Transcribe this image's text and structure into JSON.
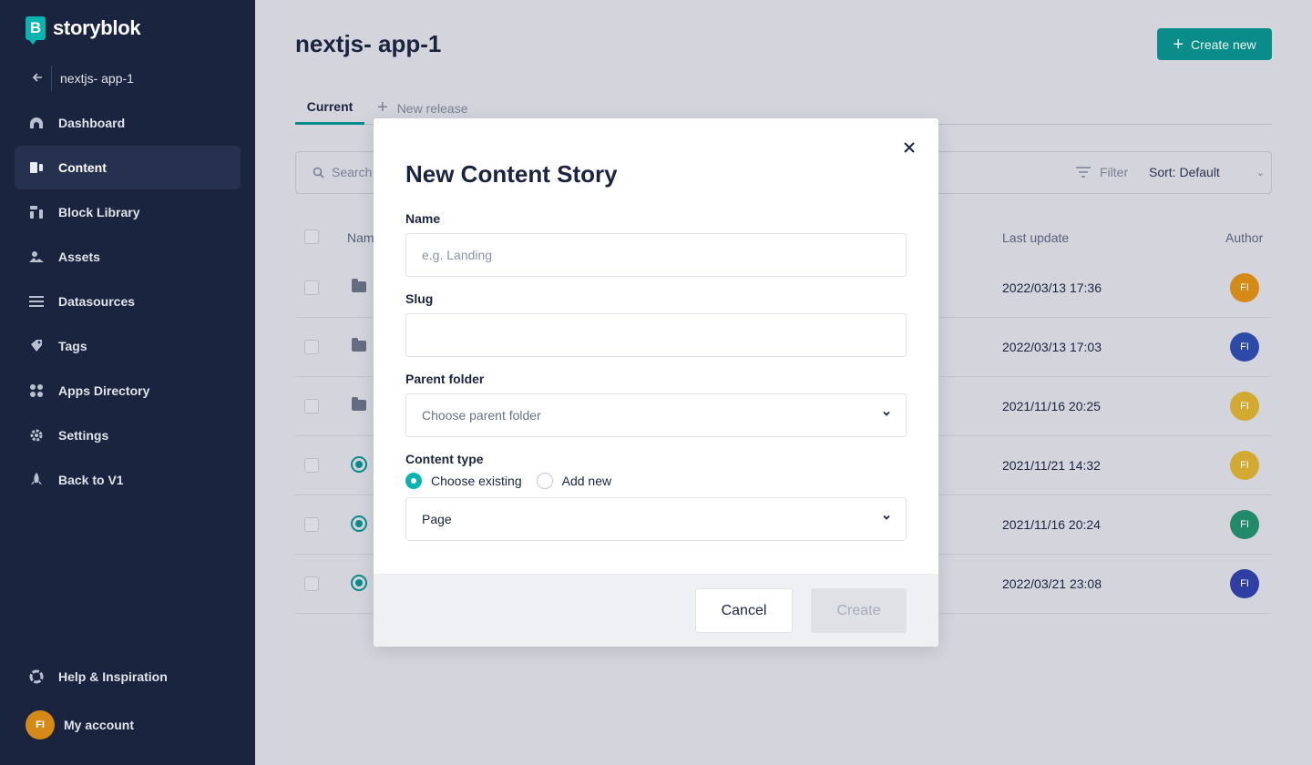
{
  "sidebar": {
    "brand": "storyblok",
    "brand_mark": "B",
    "space_name": "nextjs- app-1",
    "items": [
      {
        "label": "Dashboard",
        "icon": "dashboard-icon"
      },
      {
        "label": "Content",
        "icon": "content-icon",
        "active": true
      },
      {
        "label": "Block Library",
        "icon": "block-library-icon"
      },
      {
        "label": "Assets",
        "icon": "assets-icon"
      },
      {
        "label": "Datasources",
        "icon": "datasources-icon"
      },
      {
        "label": "Tags",
        "icon": "tags-icon"
      },
      {
        "label": "Apps Directory",
        "icon": "apps-icon"
      },
      {
        "label": "Settings",
        "icon": "gear-icon"
      },
      {
        "label": "Back to V1",
        "icon": "rocket-icon"
      }
    ],
    "help_label": "Help & Inspiration",
    "account_label": "My account",
    "account_initials": "FI"
  },
  "header": {
    "title": "nextjs- app-1",
    "create_new_label": "Create new"
  },
  "tabs": {
    "current": "Current",
    "new_release": "New release"
  },
  "toolbar": {
    "search_placeholder": "Search",
    "filter_label": "Filter",
    "sort_label": "Sort: Default"
  },
  "table": {
    "columns": {
      "name": "Nam",
      "last_update": "Last update",
      "author": "Author"
    },
    "rows": [
      {
        "type": "folder",
        "updated": "2022/03/13 17:36",
        "author": "FI",
        "author_color": "#d58a17"
      },
      {
        "type": "folder",
        "updated": "2022/03/13 17:03",
        "author": "FI",
        "author_color": "#2e4aa8"
      },
      {
        "type": "folder",
        "updated": "2021/11/16 20:25",
        "author": "FI",
        "author_color": "#d3aa31"
      },
      {
        "type": "story",
        "updated": "2021/11/21 14:32",
        "author": "FI",
        "author_color": "#d3aa31"
      },
      {
        "type": "story",
        "updated": "2021/11/16 20:24",
        "author": "FI",
        "author_color": "#22896a"
      },
      {
        "type": "story",
        "updated": "2022/03/21 23:08",
        "author": "FI",
        "author_color": "#2e3ea3"
      }
    ]
  },
  "modal": {
    "title": "New Content Story",
    "name_label": "Name",
    "name_placeholder": "e.g. Landing",
    "name_value": "",
    "slug_label": "Slug",
    "slug_value": "",
    "parent_label": "Parent folder",
    "parent_placeholder": "Choose parent folder",
    "content_type_label": "Content type",
    "choose_existing_label": "Choose existing",
    "add_new_label": "Add new",
    "content_type_value": "Page",
    "cancel_label": "Cancel",
    "create_label": "Create"
  },
  "colors": {
    "sidebar_bg": "#1b243f",
    "accent": "#09b3af",
    "primary_button": "#0a8c8a"
  }
}
